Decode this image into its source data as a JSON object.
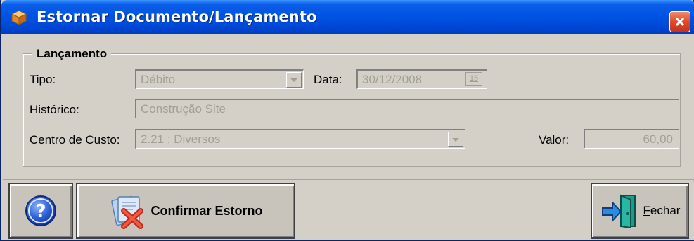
{
  "window": {
    "title": "Estornar Documento/Lançamento"
  },
  "group": {
    "legend": "Lançamento"
  },
  "form": {
    "tipo_label": "Tipo:",
    "tipo_value": "Débito",
    "data_label": "Data:",
    "data_value": "30/12/2008",
    "calendar_text": "15",
    "historico_label": "Histórico:",
    "historico_value": "Construção Site",
    "centro_label": "Centro de Custo:",
    "centro_value": "2.21 : Diversos",
    "valor_label": "Valor:",
    "valor_value": "60,00"
  },
  "buttons": {
    "confirm_label": "Confirmar Estorno",
    "close_first": "F",
    "close_rest": "echar"
  },
  "icons": {
    "app": "box-icon",
    "help": "help-icon",
    "confirm": "cancel-document-icon",
    "close": "exit-door-icon"
  },
  "colors": {
    "titlebar": "#0054e3",
    "window_face": "#d4d0c8",
    "disabled_text": "#a39f93"
  }
}
